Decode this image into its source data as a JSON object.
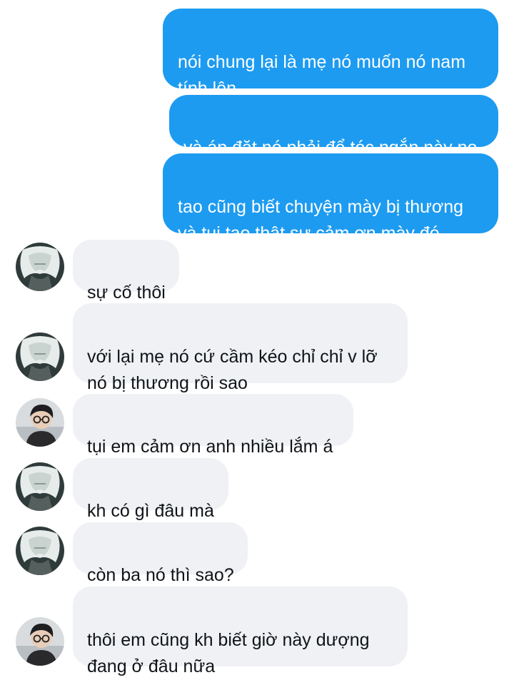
{
  "conversation": {
    "messages": [
      {
        "direction": "outgoing",
        "text": "nói chung lại là mẹ nó muốn nó nam\ntính lên"
      },
      {
        "direction": "outgoing",
        "text": "và áp đặt nó phải để tóc ngắn này nọ"
      },
      {
        "direction": "outgoing",
        "text": "tao cũng biết chuyện mày bị thương\nvà tụi tao thật sự cảm ơn mày đó"
      },
      {
        "direction": "incoming",
        "avatar": "white-hair-avatar",
        "text": "sự cố thôi"
      },
      {
        "direction": "incoming",
        "avatar": "white-hair-avatar",
        "text": "với lại mẹ nó cứ cầm kéo chỉ chỉ v lỡ\nnó bị thương rồi sao"
      },
      {
        "direction": "incoming",
        "avatar": "glasses-boy-avatar",
        "text": "tụi em cảm ơn anh nhiều lắm á"
      },
      {
        "direction": "incoming",
        "avatar": "white-hair-avatar",
        "text": "kh có gì đâu mà"
      },
      {
        "direction": "incoming",
        "avatar": "white-hair-avatar",
        "text": "còn ba nó thì sao?"
      },
      {
        "direction": "incoming",
        "avatar": "glasses-boy-avatar",
        "text": "thôi em cũng kh biết giờ này dượng\nđang ở đâu nữa"
      }
    ]
  },
  "colors": {
    "outgoing_bubble": "#1d9bf0",
    "incoming_bubble": "#eff1f4",
    "outgoing_text": "#ffffff",
    "incoming_text": "#101418"
  }
}
